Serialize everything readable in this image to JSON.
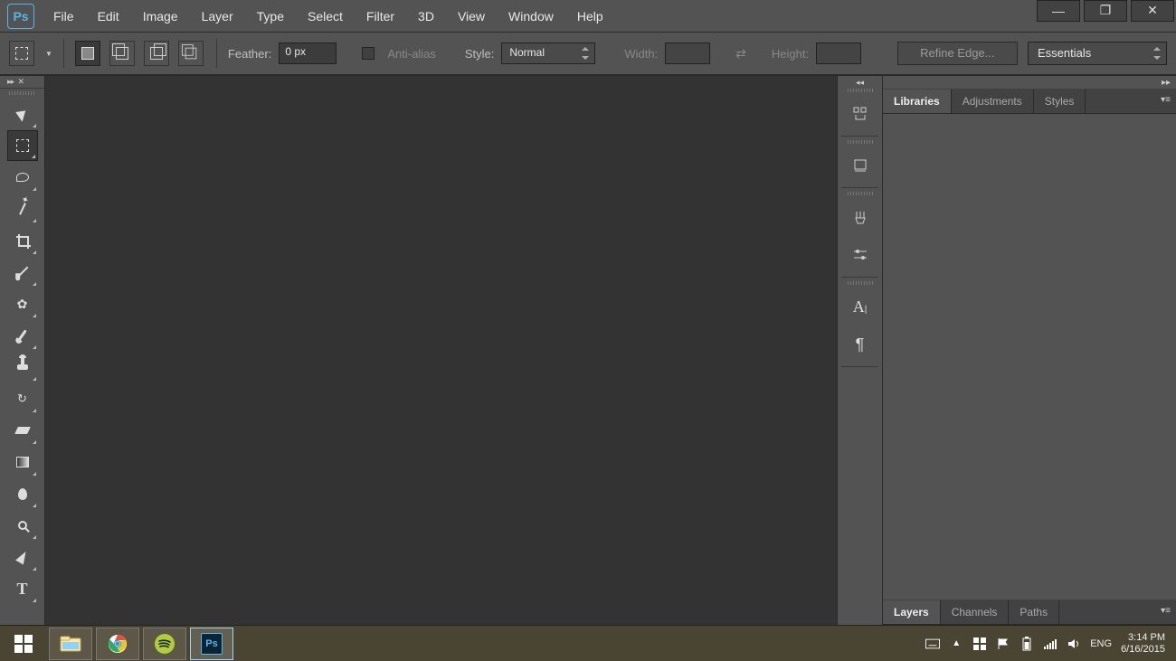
{
  "menubar": {
    "items": [
      "File",
      "Edit",
      "Image",
      "Layer",
      "Type",
      "Select",
      "Filter",
      "3D",
      "View",
      "Window",
      "Help"
    ]
  },
  "options": {
    "feather_label": "Feather:",
    "feather_value": "0 px",
    "antialias_label": "Anti-alias",
    "style_label": "Style:",
    "style_value": "Normal",
    "width_label": "Width:",
    "height_label": "Height:",
    "refine_label": "Refine Edge...",
    "workspace_value": "Essentials"
  },
  "right_panels": {
    "group1_tabs": [
      "Libraries",
      "Adjustments",
      "Styles"
    ],
    "group2_tabs": [
      "Layers",
      "Channels",
      "Paths"
    ]
  },
  "taskbar": {
    "lang": "ENG",
    "time": "3:14 PM",
    "date": "6/16/2015"
  }
}
